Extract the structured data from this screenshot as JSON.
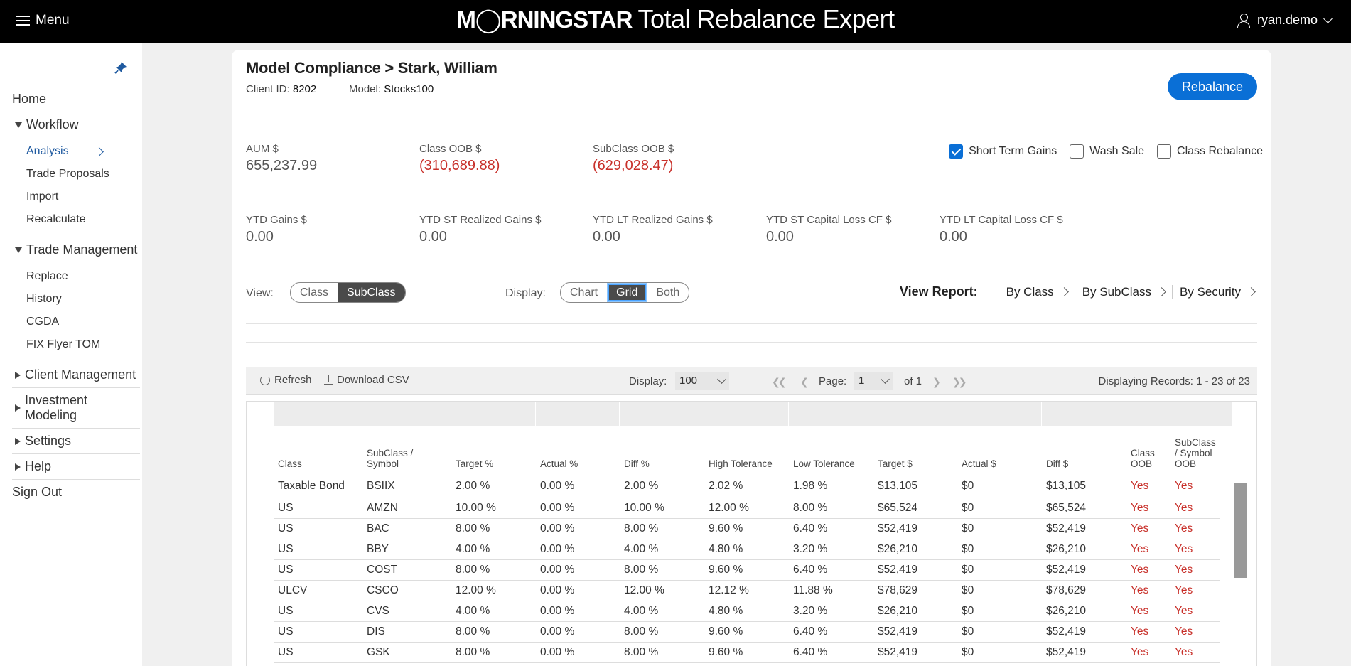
{
  "header": {
    "menu_label": "Menu",
    "brand_logo": "M◯RNINGSTAR",
    "brand_product": "Total Rebalance Expert",
    "user_name": "ryan.demo"
  },
  "sidebar": {
    "home": "Home",
    "workflow": {
      "label": "Workflow",
      "items": [
        "Analysis",
        "Trade Proposals",
        "Import",
        "Recalculate"
      ]
    },
    "trade_management": {
      "label": "Trade Management",
      "items": [
        "Replace",
        "History",
        "CGDA",
        "FIX Flyer TOM"
      ]
    },
    "client_management": "Client Management",
    "investment_modeling": "Investment Modeling",
    "settings": "Settings",
    "help": "Help",
    "sign_out": "Sign Out"
  },
  "page": {
    "title": "Model Compliance > Stark, William",
    "client_id_label": "Client ID:",
    "client_id": "8202",
    "model_label": "Model:",
    "model": "Stocks100",
    "rebalance_label": "Rebalance"
  },
  "stats_row1": [
    {
      "label": "AUM $",
      "value": "655,237.99",
      "negative": false
    },
    {
      "label": "Class OOB $",
      "value": "(310,689.88)",
      "negative": true
    },
    {
      "label": "SubClass OOB $",
      "value": "(629,028.47)",
      "negative": true
    }
  ],
  "options": {
    "short_term_gains": {
      "label": "Short Term Gains",
      "checked": true
    },
    "wash_sale": {
      "label": "Wash Sale",
      "checked": false
    },
    "class_rebalance": {
      "label": "Class Rebalance",
      "checked": false
    }
  },
  "stats_row2": [
    {
      "label": "YTD Gains $",
      "value": "0.00"
    },
    {
      "label": "YTD ST Realized Gains $",
      "value": "0.00"
    },
    {
      "label": "YTD LT Realized Gains $",
      "value": "0.00"
    },
    {
      "label": "YTD ST Capital Loss CF $",
      "value": "0.00"
    },
    {
      "label": "YTD LT Capital Loss CF $",
      "value": "0.00"
    }
  ],
  "view": {
    "label": "View:",
    "options": [
      "Class",
      "SubClass"
    ],
    "selected": "SubClass"
  },
  "display": {
    "label": "Display:",
    "options": [
      "Chart",
      "Grid",
      "Both"
    ],
    "selected": "Grid"
  },
  "report": {
    "label": "View Report:",
    "links": [
      "By Class",
      "By SubClass",
      "By Security"
    ]
  },
  "toolbar": {
    "refresh_label": "Refresh",
    "download_label": "Download CSV",
    "display_label": "Display:",
    "page_size": "100",
    "page_label": "Page:",
    "page_number": "1",
    "of_label": "of 1",
    "records_text": "Displaying Records: 1 - 23 of 23"
  },
  "table": {
    "columns": [
      "Class",
      "SubClass / Symbol",
      "Target %",
      "Actual %",
      "Diff %",
      "High Tolerance",
      "Low Tolerance",
      "Target $",
      "Actual $",
      "Diff $",
      "Class OOB",
      "SubClass / Symbol OOB"
    ],
    "rows": [
      [
        "Taxable Bond",
        "BSIIX",
        "2.00 %",
        "0.00 %",
        "2.00 %",
        "2.02 %",
        "1.98 %",
        "$13,105",
        "$0",
        "$13,105",
        "Yes",
        "Yes"
      ],
      [
        "US",
        "AMZN",
        "10.00 %",
        "0.00 %",
        "10.00 %",
        "12.00 %",
        "8.00 %",
        "$65,524",
        "$0",
        "$65,524",
        "Yes",
        "Yes"
      ],
      [
        "US",
        "BAC",
        "8.00 %",
        "0.00 %",
        "8.00 %",
        "9.60 %",
        "6.40 %",
        "$52,419",
        "$0",
        "$52,419",
        "Yes",
        "Yes"
      ],
      [
        "US",
        "BBY",
        "4.00 %",
        "0.00 %",
        "4.00 %",
        "4.80 %",
        "3.20 %",
        "$26,210",
        "$0",
        "$26,210",
        "Yes",
        "Yes"
      ],
      [
        "US",
        "COST",
        "8.00 %",
        "0.00 %",
        "8.00 %",
        "9.60 %",
        "6.40 %",
        "$52,419",
        "$0",
        "$52,419",
        "Yes",
        "Yes"
      ],
      [
        "ULCV",
        "CSCO",
        "12.00 %",
        "0.00 %",
        "12.00 %",
        "12.12 %",
        "11.88 %",
        "$78,629",
        "$0",
        "$78,629",
        "Yes",
        "Yes"
      ],
      [
        "US",
        "CVS",
        "4.00 %",
        "0.00 %",
        "4.00 %",
        "4.80 %",
        "3.20 %",
        "$26,210",
        "$0",
        "$26,210",
        "Yes",
        "Yes"
      ],
      [
        "US",
        "DIS",
        "8.00 %",
        "0.00 %",
        "8.00 %",
        "9.60 %",
        "6.40 %",
        "$52,419",
        "$0",
        "$52,419",
        "Yes",
        "Yes"
      ],
      [
        "US",
        "GSK",
        "8.00 %",
        "0.00 %",
        "8.00 %",
        "9.60 %",
        "6.40 %",
        "$52,419",
        "$0",
        "$52,419",
        "Yes",
        "Yes"
      ]
    ]
  },
  "colors": {
    "accent": "#0a6fd6",
    "negative": "#c8302a",
    "link_active": "#1f5aa0"
  }
}
